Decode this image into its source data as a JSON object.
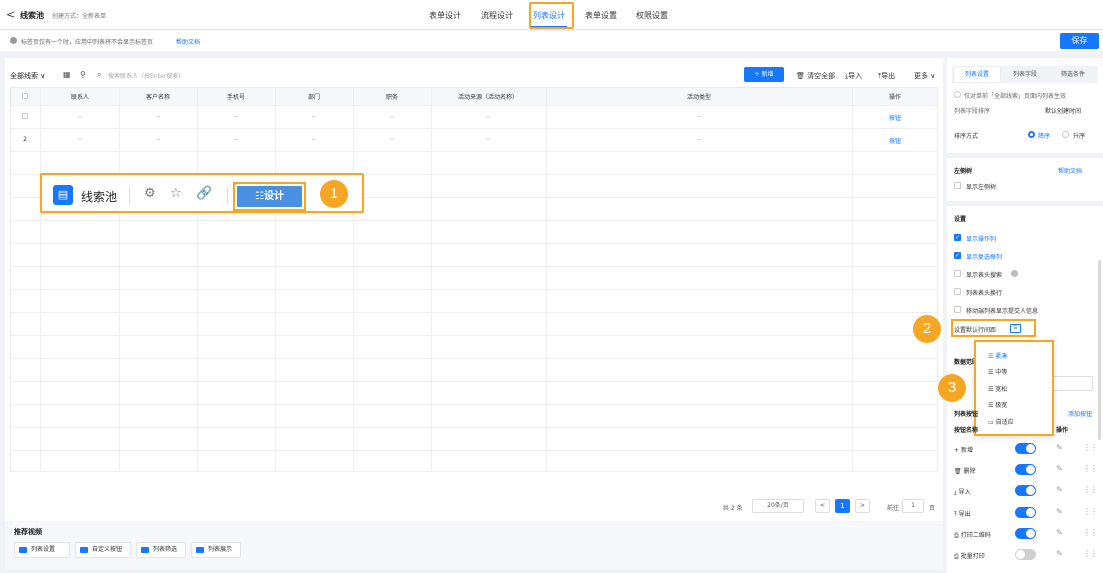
{
  "header": {
    "back": "<",
    "app_title": "线索池",
    "created_label": "创建方式：全新表单",
    "tabs": [
      "表单设计",
      "流程设计",
      "列表设计",
      "表单设置",
      "权限设置"
    ],
    "active_tab": "列表设计"
  },
  "notice": {
    "text": "标签页仅有一个时，应用中列表将不会显示标签页",
    "link": "帮助文档"
  },
  "save_label": "保存",
  "toolbar": {
    "filter_label": "全部线索",
    "search_placeholder": "搜索联系人（按Enter搜索）",
    "new_label": "+ 新增",
    "clear_label": "清空全部",
    "import_label": "导入",
    "export_label": "导出",
    "more_label": "更多"
  },
  "table": {
    "columns": [
      "联系人",
      "客户名称",
      "手机号",
      "部门",
      "职务",
      "活动来源（活动名称）",
      "活动类型",
      "操作"
    ],
    "rows": [
      {
        "index": "",
        "cells": [
          "--",
          "--",
          "--",
          "--",
          "--",
          "--",
          "--"
        ],
        "action": "按钮"
      },
      {
        "index": "2",
        "cells": [
          "--",
          "--",
          "--",
          "--",
          "--",
          "--",
          "--"
        ],
        "action": "按钮"
      }
    ]
  },
  "overlay_card": {
    "title": "线索池",
    "design_label": "设计",
    "design_icon": "sliders-icon"
  },
  "badges": [
    "1",
    "2",
    "3"
  ],
  "pagination": {
    "total": "共 2 条",
    "page_size": "20条/页",
    "prev": "<",
    "current": "1",
    "next": ">",
    "goto_label": "前往",
    "goto_value": "1",
    "page_suffix": "页"
  },
  "recommended": {
    "title": "推荐视频",
    "videos": [
      "列表设置",
      "自定义按钮",
      "列表筛选",
      "列表展示"
    ]
  },
  "panel": {
    "tabs": [
      "列表设置",
      "列表字段",
      "筛选条件"
    ],
    "active_tab": "列表设置",
    "radio_note": "仅对单前「全部线索」页面内列表生效",
    "sort_field_label": "列表字段排序",
    "sort_field_value": "默认创建时间",
    "sort_order_label": "排序方式",
    "sort_desc": "降序",
    "sort_asc": "升序",
    "left_tree_title": "左侧树",
    "help_link": "帮助文档",
    "left_tree_option": "显示左侧树",
    "settings_title": "设置",
    "settings": [
      {
        "label": "显示操作列",
        "checked": true
      },
      {
        "label": "显示复选框列",
        "checked": true
      },
      {
        "label": "显示表头搜索",
        "checked": false
      },
      {
        "label": "列表表头换行",
        "checked": false
      },
      {
        "label": "移动端列表显示提交人信息",
        "checked": false
      }
    ],
    "density_label": "设置默认行间距",
    "density_options": [
      "紧凑",
      "中等",
      "宽松",
      "极宽",
      "自适应"
    ],
    "density_selected": "紧凑",
    "data_range_label": "数据范围",
    "buttons_label": "列表按钮",
    "add_button_link": "添加按钮",
    "buttons_col_name": "按钮名称",
    "buttons_col_action": "操作",
    "buttons": [
      {
        "label": "新增",
        "icon": "plus-icon",
        "on": true
      },
      {
        "label": "删除",
        "icon": "trash-icon",
        "on": true
      },
      {
        "label": "导入",
        "icon": "import-icon",
        "on": true
      },
      {
        "label": "导出",
        "icon": "export-icon",
        "on": true
      },
      {
        "label": "打印二维码",
        "icon": "print-icon",
        "on": true
      },
      {
        "label": "批量打印",
        "icon": "print-icon",
        "on": false
      }
    ]
  },
  "colors": {
    "primary": "#1677ff",
    "highlight": "#f5a623",
    "toggle_off": "#d0d0d0"
  }
}
